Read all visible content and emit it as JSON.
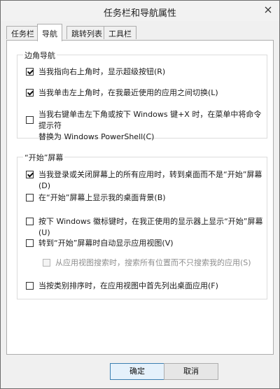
{
  "window": {
    "title": "任务栏和导航属性"
  },
  "tabs": [
    {
      "label": "任务栏"
    },
    {
      "label": "导航"
    },
    {
      "label": "跳转列表"
    },
    {
      "label": "工具栏"
    }
  ],
  "corner_nav": {
    "title": "边角导航",
    "options": [
      {
        "label": "当我指向右上角时，显示超级按钮(R)",
        "checked": true
      },
      {
        "label": "当我单击左上角时，在我最近使用的应用之间切换(L)",
        "checked": true
      },
      {
        "label": "当我右键单击左下角或按下 Windows 键+X 时，在菜单中将命令提示符",
        "label2": "替换为 Windows PowerShell(C)",
        "checked": false
      }
    ]
  },
  "start_screen": {
    "title": "“开始”屏幕",
    "options": [
      {
        "label": "当我登录或关闭屏幕上的所有应用时，转到桌面而不是“开始”屏幕(D)",
        "checked": true
      },
      {
        "label": "在“开始”屏幕上显示我的桌面背景(B)",
        "checked": false
      },
      {
        "label": "按下 Windows 徽标键时，在我正使用的显示器上显示“开始”屏幕(U)",
        "checked": false
      },
      {
        "label": "转到“开始”屏幕时自动显示应用视图(V)",
        "checked": false
      },
      {
        "label": "从应用视图搜索时，搜索所有位置而不只搜索我的应用(S)",
        "checked": false,
        "disabled": true
      },
      {
        "label": "当按类别排序时，在应用视图中首先列出桌面应用(F)",
        "checked": false
      }
    ]
  },
  "buttons": {
    "ok": "确定",
    "cancel": "取消"
  }
}
